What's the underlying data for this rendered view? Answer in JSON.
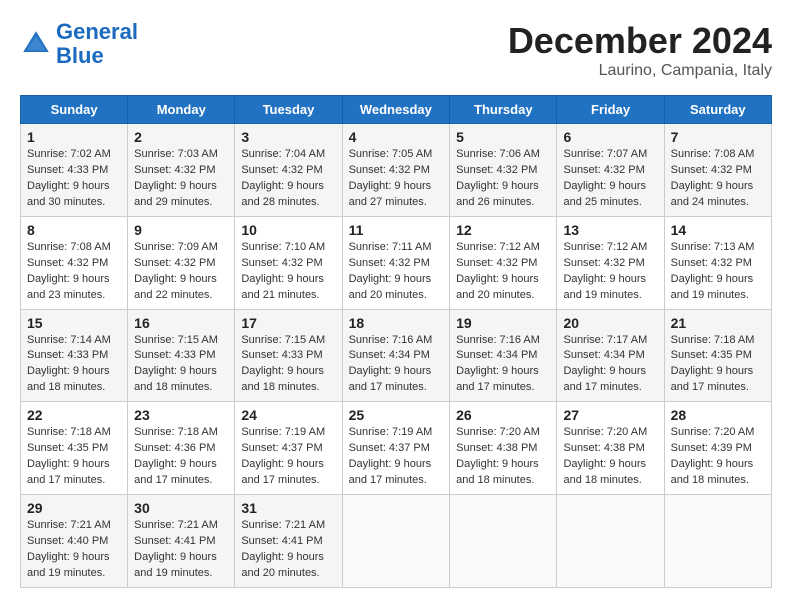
{
  "header": {
    "logo_line1": "General",
    "logo_line2": "Blue",
    "month_title": "December 2024",
    "location": "Laurino, Campania, Italy"
  },
  "days_of_week": [
    "Sunday",
    "Monday",
    "Tuesday",
    "Wednesday",
    "Thursday",
    "Friday",
    "Saturday"
  ],
  "weeks": [
    [
      {
        "day": 1,
        "sunrise": "7:02 AM",
        "sunset": "4:33 PM",
        "daylight": "9 hours and 30 minutes."
      },
      {
        "day": 2,
        "sunrise": "7:03 AM",
        "sunset": "4:32 PM",
        "daylight": "9 hours and 29 minutes."
      },
      {
        "day": 3,
        "sunrise": "7:04 AM",
        "sunset": "4:32 PM",
        "daylight": "9 hours and 28 minutes."
      },
      {
        "day": 4,
        "sunrise": "7:05 AM",
        "sunset": "4:32 PM",
        "daylight": "9 hours and 27 minutes."
      },
      {
        "day": 5,
        "sunrise": "7:06 AM",
        "sunset": "4:32 PM",
        "daylight": "9 hours and 26 minutes."
      },
      {
        "day": 6,
        "sunrise": "7:07 AM",
        "sunset": "4:32 PM",
        "daylight": "9 hours and 25 minutes."
      },
      {
        "day": 7,
        "sunrise": "7:08 AM",
        "sunset": "4:32 PM",
        "daylight": "9 hours and 24 minutes."
      }
    ],
    [
      {
        "day": 8,
        "sunrise": "7:08 AM",
        "sunset": "4:32 PM",
        "daylight": "9 hours and 23 minutes."
      },
      {
        "day": 9,
        "sunrise": "7:09 AM",
        "sunset": "4:32 PM",
        "daylight": "9 hours and 22 minutes."
      },
      {
        "day": 10,
        "sunrise": "7:10 AM",
        "sunset": "4:32 PM",
        "daylight": "9 hours and 21 minutes."
      },
      {
        "day": 11,
        "sunrise": "7:11 AM",
        "sunset": "4:32 PM",
        "daylight": "9 hours and 20 minutes."
      },
      {
        "day": 12,
        "sunrise": "7:12 AM",
        "sunset": "4:32 PM",
        "daylight": "9 hours and 20 minutes."
      },
      {
        "day": 13,
        "sunrise": "7:12 AM",
        "sunset": "4:32 PM",
        "daylight": "9 hours and 19 minutes."
      },
      {
        "day": 14,
        "sunrise": "7:13 AM",
        "sunset": "4:32 PM",
        "daylight": "9 hours and 19 minutes."
      }
    ],
    [
      {
        "day": 15,
        "sunrise": "7:14 AM",
        "sunset": "4:33 PM",
        "daylight": "9 hours and 18 minutes."
      },
      {
        "day": 16,
        "sunrise": "7:15 AM",
        "sunset": "4:33 PM",
        "daylight": "9 hours and 18 minutes."
      },
      {
        "day": 17,
        "sunrise": "7:15 AM",
        "sunset": "4:33 PM",
        "daylight": "9 hours and 18 minutes."
      },
      {
        "day": 18,
        "sunrise": "7:16 AM",
        "sunset": "4:34 PM",
        "daylight": "9 hours and 17 minutes."
      },
      {
        "day": 19,
        "sunrise": "7:16 AM",
        "sunset": "4:34 PM",
        "daylight": "9 hours and 17 minutes."
      },
      {
        "day": 20,
        "sunrise": "7:17 AM",
        "sunset": "4:34 PM",
        "daylight": "9 hours and 17 minutes."
      },
      {
        "day": 21,
        "sunrise": "7:18 AM",
        "sunset": "4:35 PM",
        "daylight": "9 hours and 17 minutes."
      }
    ],
    [
      {
        "day": 22,
        "sunrise": "7:18 AM",
        "sunset": "4:35 PM",
        "daylight": "9 hours and 17 minutes."
      },
      {
        "day": 23,
        "sunrise": "7:18 AM",
        "sunset": "4:36 PM",
        "daylight": "9 hours and 17 minutes."
      },
      {
        "day": 24,
        "sunrise": "7:19 AM",
        "sunset": "4:37 PM",
        "daylight": "9 hours and 17 minutes."
      },
      {
        "day": 25,
        "sunrise": "7:19 AM",
        "sunset": "4:37 PM",
        "daylight": "9 hours and 17 minutes."
      },
      {
        "day": 26,
        "sunrise": "7:20 AM",
        "sunset": "4:38 PM",
        "daylight": "9 hours and 18 minutes."
      },
      {
        "day": 27,
        "sunrise": "7:20 AM",
        "sunset": "4:38 PM",
        "daylight": "9 hours and 18 minutes."
      },
      {
        "day": 28,
        "sunrise": "7:20 AM",
        "sunset": "4:39 PM",
        "daylight": "9 hours and 18 minutes."
      }
    ],
    [
      {
        "day": 29,
        "sunrise": "7:21 AM",
        "sunset": "4:40 PM",
        "daylight": "9 hours and 19 minutes."
      },
      {
        "day": 30,
        "sunrise": "7:21 AM",
        "sunset": "4:41 PM",
        "daylight": "9 hours and 19 minutes."
      },
      {
        "day": 31,
        "sunrise": "7:21 AM",
        "sunset": "4:41 PM",
        "daylight": "9 hours and 20 minutes."
      },
      null,
      null,
      null,
      null
    ]
  ],
  "labels": {
    "sunrise": "Sunrise:",
    "sunset": "Sunset:",
    "daylight": "Daylight:"
  }
}
